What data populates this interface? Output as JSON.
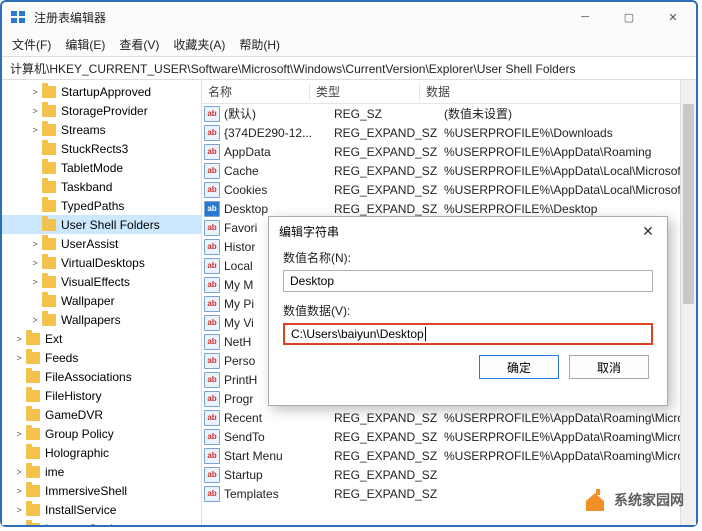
{
  "window": {
    "title": "注册表编辑器",
    "menus": [
      "文件(F)",
      "编辑(E)",
      "查看(V)",
      "收藏夹(A)",
      "帮助(H)"
    ],
    "path": "计算机\\HKEY_CURRENT_USER\\Software\\Microsoft\\Windows\\CurrentVersion\\Explorer\\User Shell Folders"
  },
  "tree": {
    "items": [
      {
        "label": "StartupApproved",
        "depth": 2,
        "chev": ">"
      },
      {
        "label": "StorageProvider",
        "depth": 2,
        "chev": ">"
      },
      {
        "label": "Streams",
        "depth": 2,
        "chev": ">"
      },
      {
        "label": "StuckRects3",
        "depth": 2,
        "chev": ""
      },
      {
        "label": "TabletMode",
        "depth": 2,
        "chev": ""
      },
      {
        "label": "Taskband",
        "depth": 2,
        "chev": ""
      },
      {
        "label": "TypedPaths",
        "depth": 2,
        "chev": ""
      },
      {
        "label": "User Shell Folders",
        "depth": 2,
        "chev": "",
        "selected": true
      },
      {
        "label": "UserAssist",
        "depth": 2,
        "chev": ">"
      },
      {
        "label": "VirtualDesktops",
        "depth": 2,
        "chev": ">"
      },
      {
        "label": "VisualEffects",
        "depth": 2,
        "chev": ">"
      },
      {
        "label": "Wallpaper",
        "depth": 2,
        "chev": ""
      },
      {
        "label": "Wallpapers",
        "depth": 2,
        "chev": ">"
      },
      {
        "label": "Ext",
        "depth": 1,
        "chev": ">"
      },
      {
        "label": "Feeds",
        "depth": 1,
        "chev": ">"
      },
      {
        "label": "FileAssociations",
        "depth": 1,
        "chev": ""
      },
      {
        "label": "FileHistory",
        "depth": 1,
        "chev": ""
      },
      {
        "label": "GameDVR",
        "depth": 1,
        "chev": ""
      },
      {
        "label": "Group Policy",
        "depth": 1,
        "chev": ">"
      },
      {
        "label": "Holographic",
        "depth": 1,
        "chev": ""
      },
      {
        "label": "ime",
        "depth": 1,
        "chev": ">"
      },
      {
        "label": "ImmersiveShell",
        "depth": 1,
        "chev": ">"
      },
      {
        "label": "InstallService",
        "depth": 1,
        "chev": ">"
      },
      {
        "label": "Internet Settings",
        "depth": 1,
        "chev": ">"
      }
    ]
  },
  "list": {
    "headers": {
      "name": "名称",
      "type": "类型",
      "data": "数据"
    },
    "rows": [
      {
        "name": "(默认)",
        "type": "REG_SZ",
        "data": "(数值未设置)",
        "selected": false
      },
      {
        "name": "{374DE290-12...",
        "type": "REG_EXPAND_SZ",
        "data": "%USERPROFILE%\\Downloads",
        "selected": false
      },
      {
        "name": "AppData",
        "type": "REG_EXPAND_SZ",
        "data": "%USERPROFILE%\\AppData\\Roaming",
        "selected": false
      },
      {
        "name": "Cache",
        "type": "REG_EXPAND_SZ",
        "data": "%USERPROFILE%\\AppData\\Local\\Microsoft\\...",
        "selected": false
      },
      {
        "name": "Cookies",
        "type": "REG_EXPAND_SZ",
        "data": "%USERPROFILE%\\AppData\\Local\\Microsoft\\...",
        "selected": false
      },
      {
        "name": "Desktop",
        "type": "REG_EXPAND_SZ",
        "data": "%USERPROFILE%\\Desktop",
        "selected": true
      },
      {
        "name": "Favori",
        "type": "",
        "data": "",
        "selected": false
      },
      {
        "name": "Histor",
        "type": "",
        "data": "",
        "selected": false
      },
      {
        "name": "Local ",
        "type": "",
        "data": "",
        "selected": false
      },
      {
        "name": "My M",
        "type": "",
        "data": "",
        "selected": false
      },
      {
        "name": "My Pi",
        "type": "",
        "data": "",
        "selected": false
      },
      {
        "name": "My Vi",
        "type": "",
        "data": "",
        "selected": false
      },
      {
        "name": "NetH",
        "type": "",
        "data": "",
        "selected": false
      },
      {
        "name": "Perso",
        "type": "",
        "data": "",
        "selected": false
      },
      {
        "name": "PrintH",
        "type": "",
        "data": "",
        "selected": false
      },
      {
        "name": "Progr",
        "type": "",
        "data": "",
        "selected": false
      },
      {
        "name": "Recent",
        "type": "REG_EXPAND_SZ",
        "data": "%USERPROFILE%\\AppData\\Roaming\\Micros...",
        "selected": false
      },
      {
        "name": "SendTo",
        "type": "REG_EXPAND_SZ",
        "data": "%USERPROFILE%\\AppData\\Roaming\\Microso...",
        "selected": false
      },
      {
        "name": "Start Menu",
        "type": "REG_EXPAND_SZ",
        "data": "%USERPROFILE%\\AppData\\Roaming\\Micros...",
        "selected": false
      },
      {
        "name": "Startup",
        "type": "REG_EXPAND_SZ",
        "data": "",
        "selected": false
      },
      {
        "name": "Templates",
        "type": "REG_EXPAND_SZ",
        "data": "",
        "selected": false
      }
    ]
  },
  "dialog": {
    "title": "编辑字符串",
    "name_label": "数值名称(N):",
    "name_value": "Desktop",
    "data_label": "数值数据(V):",
    "data_value": "C:\\Users\\baiyun\\Desktop",
    "ok": "确定",
    "cancel": "取消"
  },
  "watermark": {
    "text": "系统家园网"
  }
}
